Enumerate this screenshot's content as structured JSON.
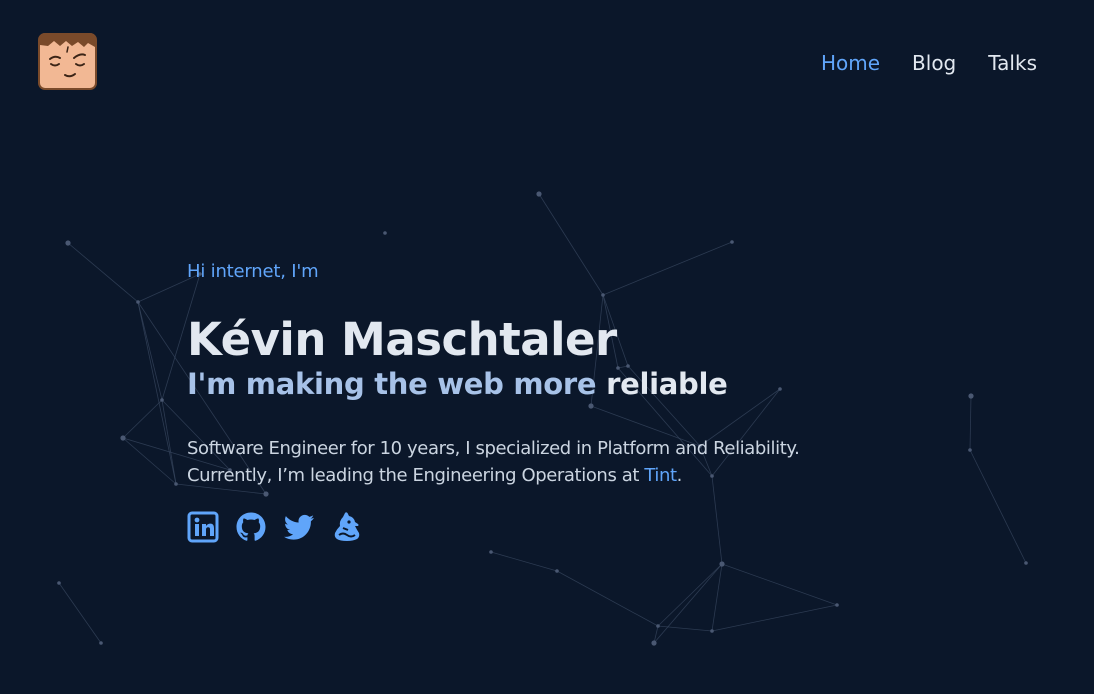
{
  "nav": {
    "items": [
      {
        "label": "Home",
        "active": true
      },
      {
        "label": "Blog",
        "active": false
      },
      {
        "label": "Talks",
        "active": false
      }
    ]
  },
  "hero": {
    "greeting": "Hi internet, I'm",
    "name": "Kévin Maschtaler",
    "tagline_prefix": "I'm making the web more",
    "tagline_highlight": "reliable",
    "bio_line1": "Software Engineer for 10 years, I specialized in Platform and Reliability.",
    "bio_line2_prefix": "Currently, I’m leading the Engineering Operations at",
    "bio_company": "Tint",
    "bio_line2_suffix": "."
  },
  "socials": [
    {
      "icon": "linkedin-icon"
    },
    {
      "icon": "github-icon"
    },
    {
      "icon": "twitter-icon"
    },
    {
      "icon": "mastodon-icon"
    }
  ],
  "colors": {
    "background": "#0b172a",
    "accent": "#60a5fa",
    "text": "#e2e8f0"
  }
}
